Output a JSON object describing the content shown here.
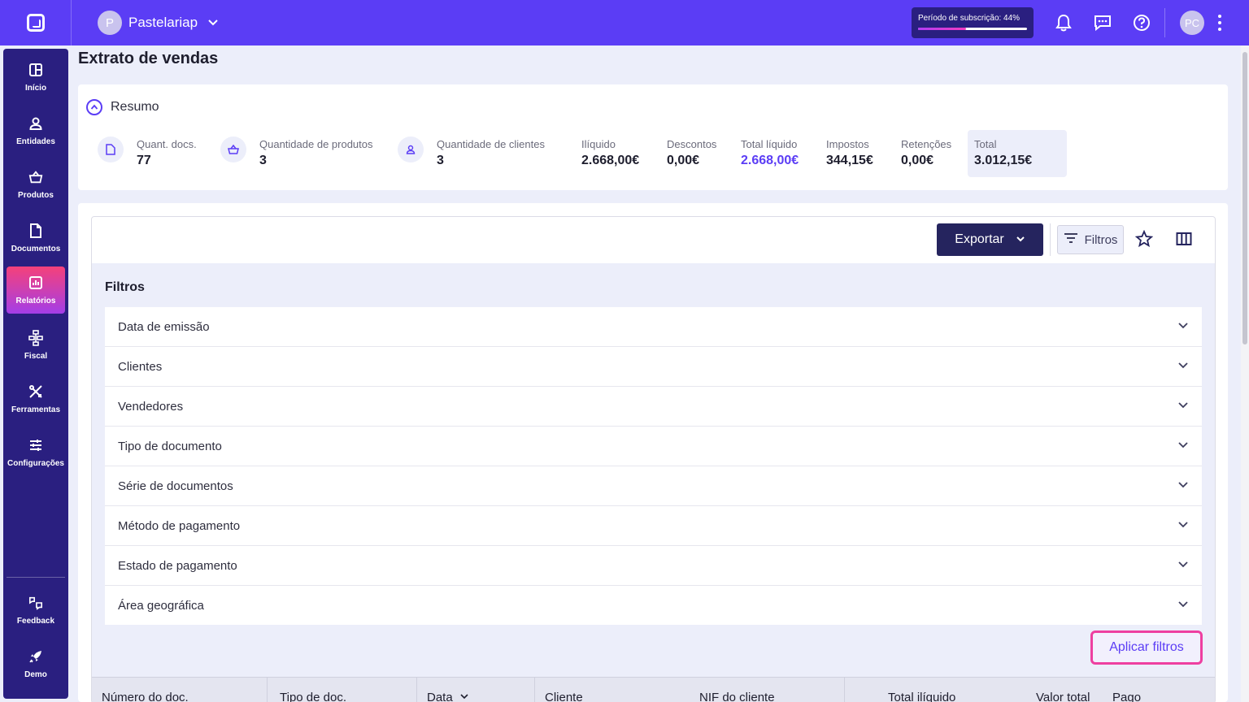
{
  "topbar": {
    "company_initial": "P",
    "company_name": "Pastelariap",
    "subscription_label": "Período de subscrição: 44%",
    "subscription_progress": 0.44,
    "user_initials": "PC"
  },
  "sidebar": {
    "items": [
      {
        "label": "Início",
        "icon": "grid-icon"
      },
      {
        "label": "Entidades",
        "icon": "person-icon"
      },
      {
        "label": "Produtos",
        "icon": "basket-icon"
      },
      {
        "label": "Documentos",
        "icon": "document-icon"
      },
      {
        "label": "Relatórios",
        "icon": "report-icon",
        "active": true
      },
      {
        "label": "Fiscal",
        "icon": "hierarchy-icon"
      },
      {
        "label": "Ferramentas",
        "icon": "tools-icon"
      },
      {
        "label": "Configurações",
        "icon": "sliders-icon"
      }
    ],
    "bottom": [
      {
        "label": "Feedback",
        "icon": "feedback-icon"
      },
      {
        "label": "Demo",
        "icon": "rocket-icon"
      }
    ]
  },
  "page": {
    "title": "Extrato de vendas"
  },
  "summary": {
    "heading": "Resumo",
    "stats": [
      {
        "label": "Quant. docs.",
        "value": "77"
      },
      {
        "label": "Quantidade de produtos",
        "value": "3"
      },
      {
        "label": "Quantidade de clientes",
        "value": "3"
      },
      {
        "label": "Ilíquido",
        "value": "2.668,00€"
      },
      {
        "label": "Descontos",
        "value": "0,00€"
      },
      {
        "label": "Total líquido",
        "value": "2.668,00€"
      },
      {
        "label": "Impostos",
        "value": "344,15€"
      },
      {
        "label": "Retenções",
        "value": "0,00€"
      },
      {
        "label": "Total",
        "value": "3.012,15€"
      }
    ]
  },
  "toolbar": {
    "export_label": "Exportar",
    "filters_label": "Filtros"
  },
  "filters": {
    "title": "Filtros",
    "items": [
      "Data de emissão",
      "Clientes",
      "Vendedores",
      "Tipo de documento",
      "Série de documentos",
      "Método de pagamento",
      "Estado de pagamento",
      "Área geográfica"
    ],
    "apply_label": "Aplicar filtros"
  },
  "table": {
    "columns": [
      "Número do doc.",
      "Tipo de doc.",
      "Data",
      "Cliente",
      "NIF do cliente",
      "Total ilíquido",
      "Valor total",
      "Pago"
    ]
  },
  "colors": {
    "brand": "#5b3df5",
    "sidebar": "#2a1f80",
    "export_button": "#25245e",
    "apply_highlight": "#ee3fa0"
  }
}
